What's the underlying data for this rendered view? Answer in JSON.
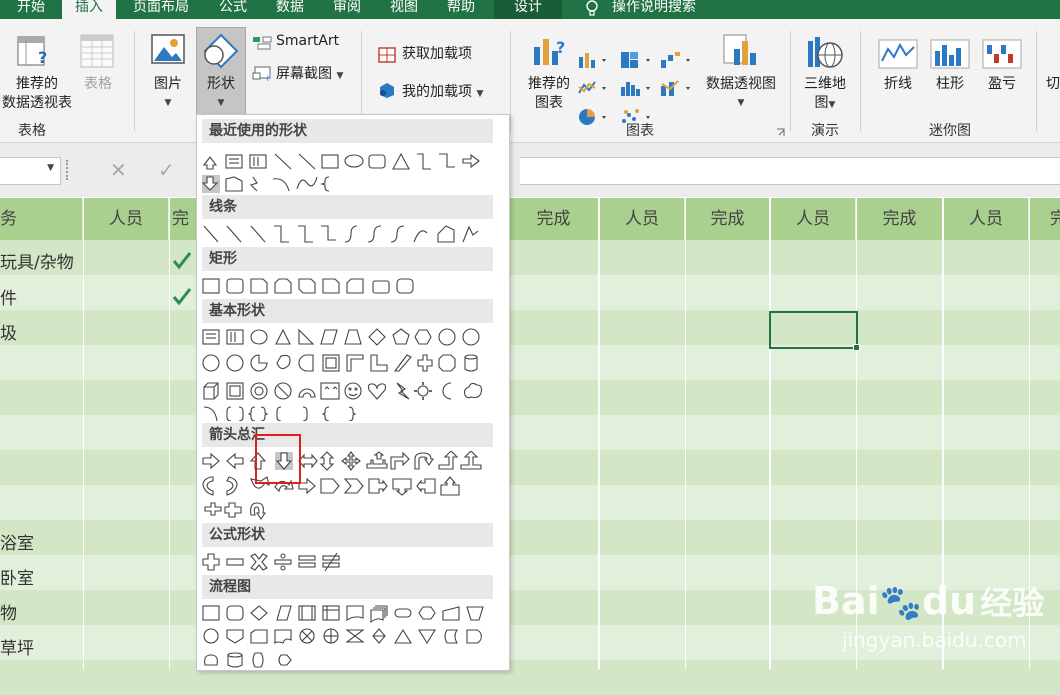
{
  "tabs": [
    "开始",
    "插入",
    "页面布局",
    "公式",
    "数据",
    "审阅",
    "视图",
    "帮助",
    "设计",
    "操作说明搜索"
  ],
  "ribbon": {
    "pivot_recommended": [
      "推荐的",
      "数据透视表"
    ],
    "table": "表格",
    "group_table": "表格",
    "pictures": "图片",
    "shapes": "形状",
    "smartart": "SmartArt",
    "screenshot": "屏幕截图",
    "get_addins": "获取加载项",
    "my_addins": "我的加载项",
    "recommended_charts": [
      "推荐的",
      "图表"
    ],
    "pivot_chart": "数据透视图",
    "group_charts": "图表",
    "map3d": [
      "三维地",
      "图"
    ],
    "group_tours": "演示",
    "sparkline_line": "折线",
    "sparkline_column": "柱形",
    "sparkline_winloss": "盈亏",
    "group_sparklines": "迷你图",
    "cut_char": "切"
  },
  "formula": {
    "cancel": "✕",
    "enter": "✓"
  },
  "grid": {
    "headers": [
      "务",
      "人员",
      "完",
      "完成",
      "人员",
      "完成",
      "人员",
      "完成",
      "人员",
      "完"
    ],
    "rows": [
      "玩具/杂物",
      "件",
      "圾",
      "",
      "",
      "",
      "",
      "",
      "浴室",
      "卧室",
      "物",
      "草坪"
    ]
  },
  "shapes_menu": {
    "sections": [
      "最近使用的形状",
      "线条",
      "矩形",
      "基本形状",
      "箭头总汇",
      "公式形状",
      "流程图"
    ]
  },
  "watermark": {
    "brand": "Bai",
    "brand2": "du",
    "cn": "经验",
    "url": "jingyan.baidu.com"
  },
  "colors": {
    "excel_green": "#217346",
    "header_green": "#a9d08e",
    "cell_green": "#e2efda",
    "highlight_red": "#e02020"
  }
}
